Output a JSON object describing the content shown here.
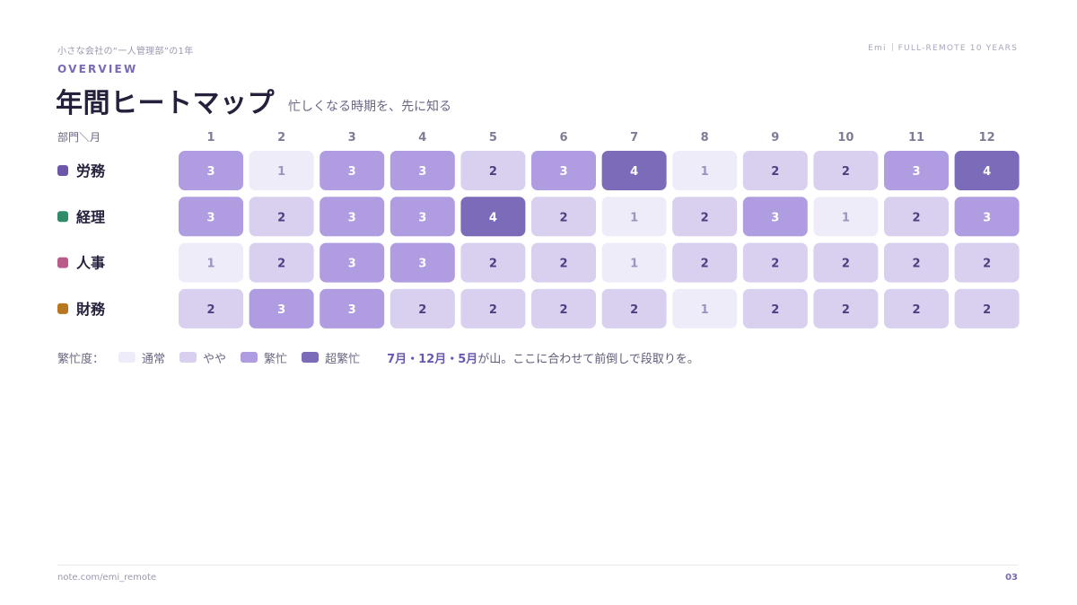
{
  "header": {
    "series_title": "小さな会社の“一人管理部”の1年",
    "brand_name": "Emi",
    "brand_tagline": "FULL-REMOTE 10 YEARS",
    "eyebrow": "OVERVIEW",
    "title": "年間ヒートマップ",
    "subtitle": "忙しくなる時期を、先に知る"
  },
  "chart_data": {
    "type": "heatmap",
    "corner_label": "部門＼月",
    "columns": [
      "1",
      "2",
      "3",
      "4",
      "5",
      "6",
      "7",
      "8",
      "9",
      "10",
      "11",
      "12"
    ],
    "rows": [
      {
        "name": "労務",
        "dot_color": "#6e57a8",
        "values": [
          3,
          1,
          3,
          3,
          2,
          3,
          4,
          1,
          2,
          2,
          3,
          4
        ]
      },
      {
        "name": "経理",
        "dot_color": "#2e8c6a",
        "values": [
          3,
          2,
          3,
          3,
          4,
          2,
          1,
          2,
          3,
          1,
          2,
          3
        ]
      },
      {
        "name": "人事",
        "dot_color": "#b95a8a",
        "values": [
          1,
          2,
          3,
          3,
          2,
          2,
          1,
          2,
          2,
          2,
          2,
          2
        ]
      },
      {
        "name": "財務",
        "dot_color": "#b8771e",
        "values": [
          2,
          3,
          3,
          2,
          2,
          2,
          2,
          1,
          2,
          2,
          2,
          2
        ]
      }
    ],
    "levels": [
      {
        "value": 1,
        "label": "通常",
        "fill": "#efecf9",
        "text": "#9b94bf"
      },
      {
        "value": 2,
        "label": "やや",
        "fill": "#d9cfef",
        "text": "#4d3f80"
      },
      {
        "value": 3,
        "label": "繁忙",
        "fill": "#b09ce0",
        "text": "#ffffff"
      },
      {
        "value": 4,
        "label": "超繁忙",
        "fill": "#7c6bb8",
        "text": "#ffffff"
      }
    ]
  },
  "legend": {
    "title": "繁忙度：",
    "items": [
      "通常",
      "やや",
      "繁忙",
      "超繁忙"
    ],
    "note_highlight": "7月・12月・5月",
    "note_rest": "が山。ここに合わせて前倒しで段取りを。"
  },
  "footer": {
    "source": "note.com/emi_remote",
    "page_number": "03"
  }
}
